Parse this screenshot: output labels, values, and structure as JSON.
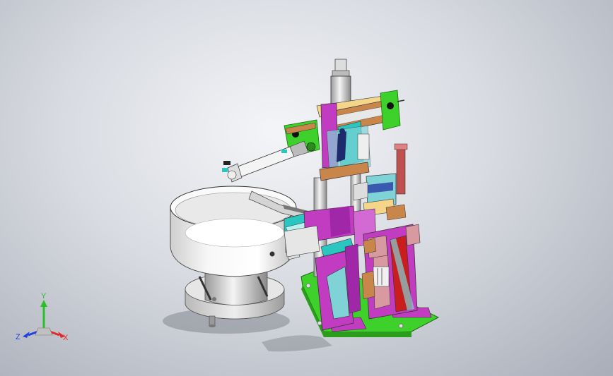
{
  "triad": {
    "x_label": "X",
    "y_label": "Y",
    "z_label": "Z",
    "x_color": "#e02a2a",
    "y_color": "#27c227",
    "z_color": "#2040d8"
  },
  "colors": {
    "bowl": "#f2f2f2",
    "green_base": "#3fd12b",
    "magenta": "#c23cc2",
    "cyan": "#7fd3d6",
    "orange": "#c8864b",
    "red": "#c81e1e"
  }
}
